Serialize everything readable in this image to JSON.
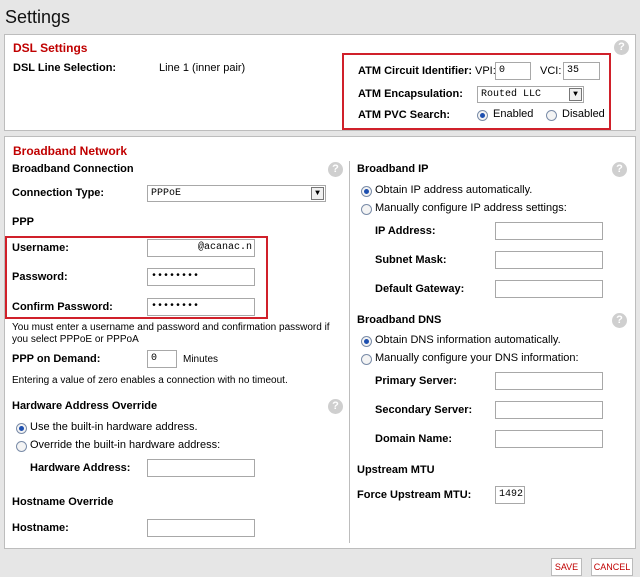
{
  "page": {
    "title": "Settings"
  },
  "dsl": {
    "section_title": "DSL Settings",
    "line_selection_label": "DSL Line Selection:",
    "line_selection_value": "Line 1 (inner pair)",
    "atm_circuit_label": "ATM Circuit Identifier:",
    "vpi_label": "VPI:",
    "vpi_value": "0",
    "vci_label": "VCI:",
    "vci_value": "35",
    "atm_encapsulation_label": "ATM Encapsulation:",
    "atm_encapsulation_value": "Routed LLC",
    "pvc_search_label": "ATM PVC Search:",
    "pvc_enabled_label": "Enabled",
    "pvc_disabled_label": "Disabled",
    "pvc_selected": "Enabled"
  },
  "broadband": {
    "section_title": "Broadband Network",
    "connection": {
      "heading": "Broadband Connection",
      "type_label": "Connection Type:",
      "type_value": "PPPoE"
    },
    "ppp": {
      "heading": "PPP",
      "username_label": "Username:",
      "username_value": "@acanac.n",
      "password_label": "Password:",
      "password_value": "••••••••",
      "confirm_label": "Confirm Password:",
      "confirm_value": "••••••••",
      "note": "You must enter a username and password and confirmation password if you select PPPoE or PPPoA",
      "on_demand_label": "PPP on Demand:",
      "on_demand_value": "0",
      "on_demand_unit": "Minutes",
      "zero_note": "Entering a value of zero enables a connection with no timeout."
    },
    "hardware": {
      "heading": "Hardware Address Override",
      "option_builtin": "Use the built-in hardware address.",
      "option_override": "Override the built-in hardware address:",
      "address_label": "Hardware Address:",
      "address_value": ""
    },
    "hostname": {
      "heading": "Hostname Override",
      "label": "Hostname:",
      "value": ""
    },
    "ip": {
      "heading": "Broadband IP",
      "option_auto": "Obtain IP address automatically.",
      "option_manual": "Manually configure IP address settings:",
      "ip_label": "IP Address:",
      "subnet_label": "Subnet Mask:",
      "gateway_label": "Default Gateway:"
    },
    "dns": {
      "heading": "Broadband DNS",
      "option_auto": "Obtain DNS information automatically.",
      "option_manual": "Manually configure your DNS information:",
      "primary_label": "Primary Server:",
      "secondary_label": "Secondary Server:",
      "domain_label": "Domain Name:"
    },
    "mtu": {
      "heading": "Upstream MTU",
      "label": "Force Upstream MTU:",
      "value": "1492"
    }
  },
  "buttons": {
    "save": "SAVE",
    "cancel": "CANCEL"
  },
  "help_glyph": "?",
  "select_arrow": "▼",
  "colors": {
    "section_title": "#c00000",
    "highlight_box": "#d0202a",
    "radio_selected": "#1d4fb0"
  }
}
